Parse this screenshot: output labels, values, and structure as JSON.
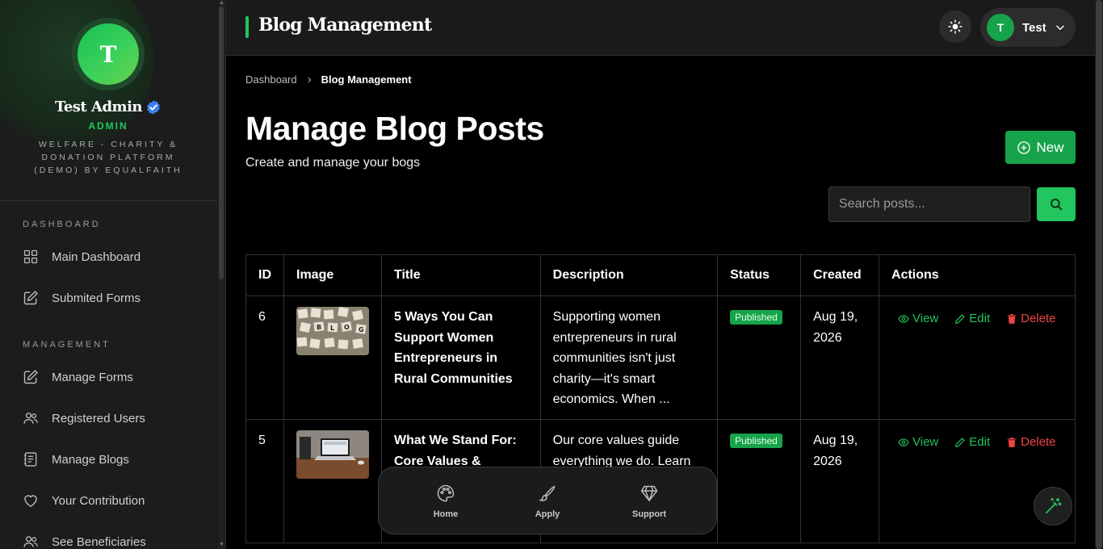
{
  "sidebar": {
    "avatar_initial": "T",
    "name": "Test Admin",
    "role": "ADMIN",
    "org": "WELFARE - CHARITY & DONATION PLATFORM (DEMO) BY EQUALFAITH",
    "sections": [
      {
        "label": "DASHBOARD",
        "items": [
          {
            "label": "Main Dashboard",
            "icon": "grid-icon"
          },
          {
            "label": "Submited Forms",
            "icon": "edit-square-icon"
          }
        ]
      },
      {
        "label": "MANAGEMENT",
        "items": [
          {
            "label": "Manage Forms",
            "icon": "edit-square-icon"
          },
          {
            "label": "Registered Users",
            "icon": "users-icon"
          },
          {
            "label": "Manage Blogs",
            "icon": "document-list-icon"
          },
          {
            "label": "Your Contribution",
            "icon": "heart-icon"
          },
          {
            "label": "See Beneficiaries",
            "icon": "users-icon"
          }
        ]
      }
    ]
  },
  "header": {
    "title": "Blog Management",
    "user_initial": "T",
    "user_name": "Test"
  },
  "breadcrumb": {
    "root": "Dashboard",
    "current": "Blog Management"
  },
  "page": {
    "title": "Manage Blog Posts",
    "subtitle": "Create and manage your bogs",
    "new_label": "New",
    "search_placeholder": "Search posts..."
  },
  "table": {
    "headers": [
      "ID",
      "Image",
      "Title",
      "Description",
      "Status",
      "Created",
      "Actions"
    ],
    "rows": [
      {
        "id": "6",
        "title": "5 Ways You Can Support Women Entrepreneurs in Rural Communities",
        "description": "Supporting women entrepreneurs in rural communities isn't just charity—it's smart economics. When ...",
        "status": "Published",
        "created": "Aug 19, 2026"
      },
      {
        "id": "5",
        "title": "What We Stand For: Core Values &",
        "description": "Our core values guide everything we do. Learn",
        "status": "Published",
        "created": "Aug 19, 2026"
      }
    ],
    "actions": {
      "view": "View",
      "edit": "Edit",
      "delete": "Delete"
    }
  },
  "bottom_nav": [
    {
      "label": "Home",
      "icon": "palette-icon"
    },
    {
      "label": "Apply",
      "icon": "brush-icon"
    },
    {
      "label": "Support",
      "icon": "diamond-icon"
    }
  ],
  "colors": {
    "accent": "#22c55e",
    "accent_dark": "#16a34a",
    "danger": "#ef4444",
    "sidebar_bg": "#1c1c1c",
    "header_bg": "#1a1a1a"
  }
}
